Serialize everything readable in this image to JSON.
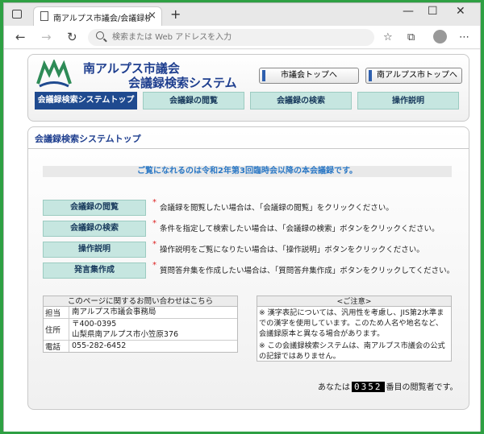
{
  "browser": {
    "tab_title": "南アルプス市議会/会議録検索シス",
    "address_placeholder": "検索または Web アドレスを入力"
  },
  "header": {
    "title_line1": "南アルプス市議会",
    "title_line2": "会議録検索システム",
    "btn_gikai_top": "市議会トップへ",
    "btn_city_top": "南アルプス市トップへ"
  },
  "nav": {
    "tabs": [
      {
        "label": "会議録検索システムトップ",
        "active": true
      },
      {
        "label": "会議録の閲覧",
        "active": false
      },
      {
        "label": "会議録の検索",
        "active": false
      },
      {
        "label": "操作説明",
        "active": false
      }
    ]
  },
  "main": {
    "section_title": "会議録検索システムトップ",
    "notice": "ご覧になれるのは令和2年第3回臨時会以降の本会議録です。",
    "actions": [
      {
        "label": "会議録の閲覧",
        "desc": "会議録を閲覧したい場合は、「会議録の閲覧」をクリックください。"
      },
      {
        "label": "会議録の検索",
        "desc": "条件を指定して検索したい場合は、「会議録の検索」ボタンをクリックください。"
      },
      {
        "label": "操作説明",
        "desc": "操作説明をご覧になりたい場合は、「操作説明」ボタンをクリックください。"
      },
      {
        "label": "発言集作成",
        "desc": "質問答弁集を作成したい場合は、「質問答弁集作成」ボタンをクリックしてください。"
      }
    ],
    "contact": {
      "heading": "このページに関するお問い合わせはこちら",
      "tanto_label": "担当",
      "tanto_value": "南アルプス市議会事務局",
      "address_label": "住所",
      "address_postal": "〒400-0395",
      "address_value": "山梨県南アルプス市小笠原376",
      "phone_label": "電話",
      "phone_value": "055-282-6452"
    },
    "caution": {
      "heading": "<ご注意>",
      "note1": "※ 漢字表記については、汎用性を考慮し、JIS第2水準までの漢字を使用しています。このため人名や地名など、会議録原本と異なる場合があります。",
      "note2": "※ この会議録検索システムは、南アルプス市議会の公式の記録ではありません。"
    },
    "counter_prefix": "あなたは",
    "counter_value": "0352",
    "counter_suffix": "番目の閲覧者です。"
  }
}
